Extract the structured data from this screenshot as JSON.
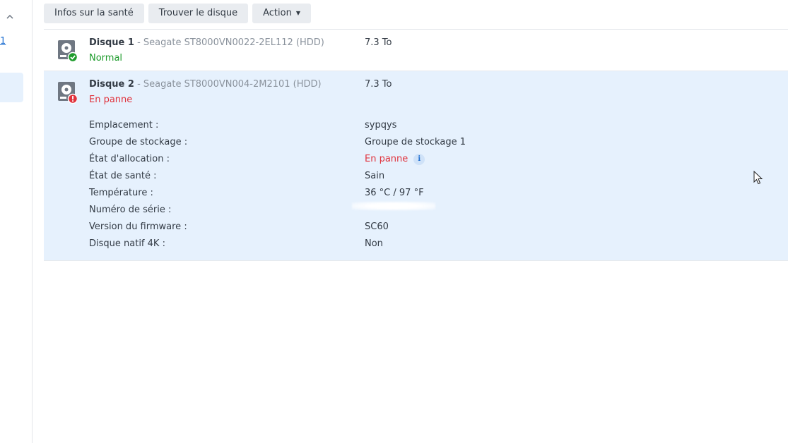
{
  "toolbar": {
    "health_info_label": "Infos sur la santé",
    "locate_disk_label": "Trouver le disque",
    "action_label": "Action"
  },
  "sidebar": {
    "link_fragment": "1"
  },
  "disks": [
    {
      "name": "Disque 1",
      "separator": " - ",
      "model": "Seagate ST8000VN0022-2EL112 (HDD)",
      "status": "Normal",
      "size": "7.3 To"
    },
    {
      "name": "Disque 2",
      "separator": " - ",
      "model": "Seagate ST8000VN004-2M2101 (HDD)",
      "status": "En panne",
      "size": "7.3 To",
      "details": {
        "location_key": "Emplacement :",
        "location_value": "sypqys",
        "pool_key": "Groupe de stockage :",
        "pool_value": "Groupe de stockage 1",
        "allocation_key": "État d'allocation :",
        "allocation_value": "En panne",
        "health_key": "État de santé :",
        "health_value": "Sain",
        "temperature_key": "Température :",
        "temperature_value": "36 °C / 97 °F",
        "serial_key": "Numéro de série :",
        "firmware_key": "Version du firmware :",
        "firmware_value": "SC60",
        "native4k_key": "Disque natif 4K :",
        "native4k_value": "Non"
      }
    }
  ],
  "colors": {
    "ok": "#1d9b2b",
    "error": "#e0323c",
    "selected_bg": "#e6f1fd",
    "accent": "#1f6fd1"
  },
  "icons": {
    "hdd": "hdd-icon",
    "ok_badge": "check-badge-icon",
    "error_badge": "exclamation-badge-icon",
    "info": "info-icon"
  }
}
